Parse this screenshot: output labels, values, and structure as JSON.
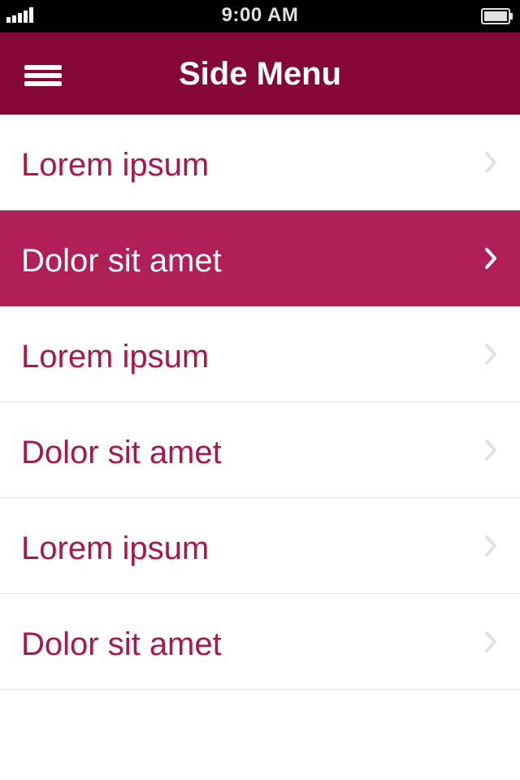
{
  "status_bar": {
    "time": "9:00 AM",
    "signal_icon": "signal-bars-icon",
    "battery_icon": "battery-icon"
  },
  "header": {
    "title": "Side Menu",
    "menu_icon": "hamburger-menu-icon",
    "background_color": "#840736"
  },
  "menu": {
    "items": [
      {
        "label": "Lorem ipsum",
        "active": false
      },
      {
        "label": "Dolor sit amet",
        "active": true
      },
      {
        "label": "Lorem ipsum",
        "active": false
      },
      {
        "label": "Dolor sit amet",
        "active": false
      },
      {
        "label": "Lorem ipsum",
        "active": false
      },
      {
        "label": "Dolor sit amet",
        "active": false
      }
    ],
    "chevron_icon": "chevron-right-icon",
    "text_color": "#a8174e",
    "active_background_color": "#b01f55"
  }
}
